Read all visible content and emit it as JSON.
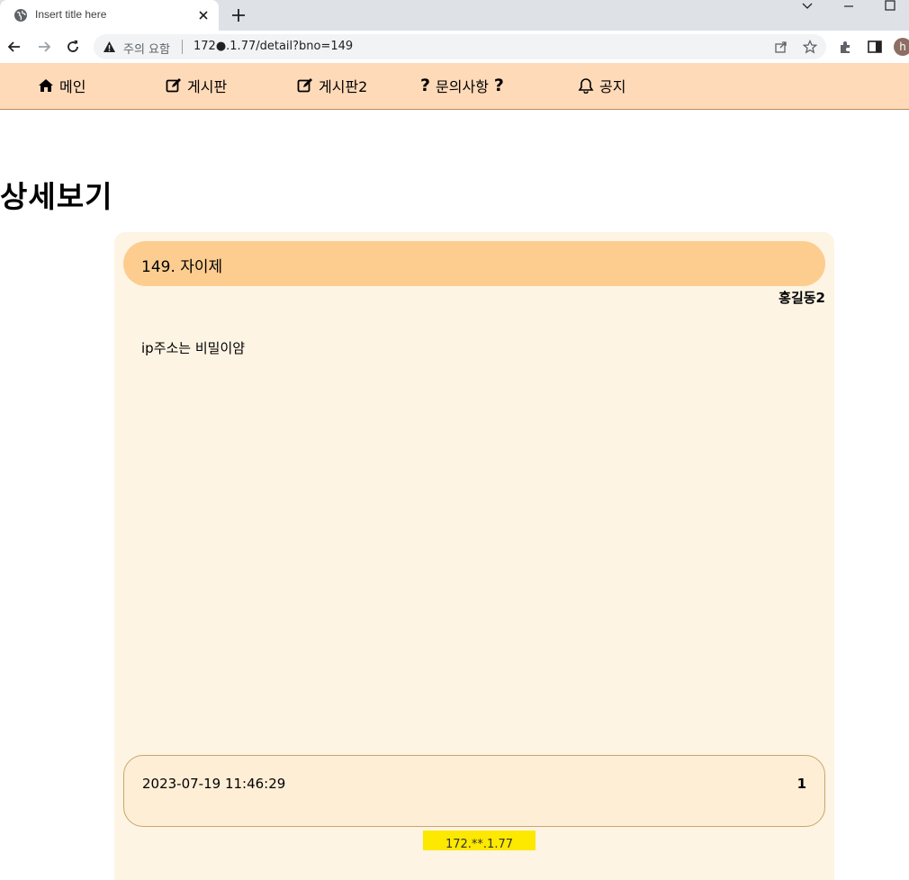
{
  "browser": {
    "tab_title": "Insert title here",
    "security_warning": "주의 요함",
    "url": "172●.1.77/detail?bno=149",
    "avatar_letter": "h"
  },
  "nav": {
    "items": [
      {
        "label": "메인",
        "icon": "home-icon"
      },
      {
        "label": "게시판",
        "icon": "edit-icon"
      },
      {
        "label": "게시판2",
        "icon": "edit-icon"
      },
      {
        "label": "문의사항",
        "icon": "question-icon",
        "prefix": "?",
        "suffix": "?"
      },
      {
        "label": "공지",
        "icon": "bell-icon"
      }
    ],
    "background": "#ffdab9"
  },
  "page": {
    "title": "상세보기"
  },
  "post": {
    "title": "149. 자이제",
    "writer": "홍길동2",
    "content": "ip주소는 비밀이얌",
    "date": "2023-07-19 11:46:29",
    "count": "1",
    "ip": "172.**.1.77"
  },
  "colors": {
    "card_bg": "#fdf4e4",
    "title_bar": "#fdcd8f",
    "meta_box": "#ffeed6",
    "ip_badge": "#fde800"
  }
}
